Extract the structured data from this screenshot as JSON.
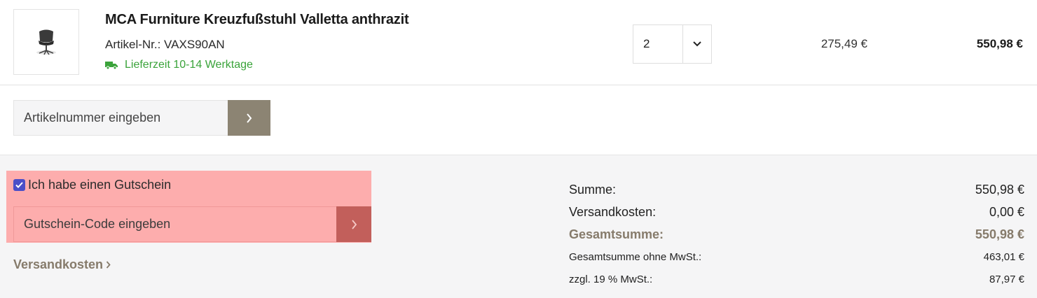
{
  "product": {
    "title": "MCA Furniture Kreuzfußstuhl Valletta anthrazit",
    "sku": "Artikel-Nr.: VAXS90AN",
    "delivery": "Lieferzeit 10-14 Werktage",
    "quantity": "2",
    "unit_price": "275,49 €",
    "total_price": "550,98 €"
  },
  "sku_entry": {
    "placeholder": "Artikelnummer eingeben"
  },
  "voucher": {
    "checkbox_label": "Ich habe einen Gutschein",
    "checked": true,
    "placeholder": "Gutschein-Code eingeben"
  },
  "shipping_link": "Versandkosten",
  "totals": [
    {
      "label": "Summe:",
      "value": "550,98 €"
    },
    {
      "label": "Versandkosten:",
      "value": "0,00 €"
    },
    {
      "label": "Gesamtsumme:",
      "value": "550,98 €"
    },
    {
      "label": "Gesamtsumme ohne MwSt.:",
      "value": "463,01 €"
    },
    {
      "label": "zzgl. 19 % MwSt.:",
      "value": "87,97 €"
    }
  ],
  "colors": {
    "accent": "#8c8473",
    "accent_text": "#867b6b",
    "delivery_green": "#3aa33a",
    "highlight": "#fdadad",
    "checkbox": "#4b4fc8"
  },
  "icons": {
    "product_image": "office-chair-image",
    "delivery": "truck-icon",
    "qty_toggle": "chevron-down-icon",
    "submit": "chevron-right-icon"
  }
}
